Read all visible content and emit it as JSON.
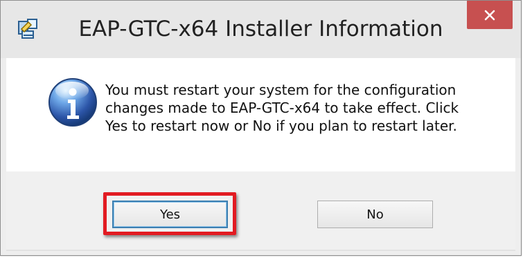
{
  "window": {
    "title": "EAP-GTC-x64 Installer Information",
    "close_icon": "close-icon",
    "app_icon": "installer-icon"
  },
  "dialog": {
    "icon": "info-icon",
    "message": "You must restart your system for the configuration\nchanges made to EAP-GTC-x64 to take effect. Click\nYes to restart now or No if you plan to restart later."
  },
  "buttons": {
    "yes": "Yes",
    "no": "No"
  },
  "colors": {
    "close_button": "#c75050",
    "highlight": "#e21b22",
    "focus_border": "#3c7fb1"
  }
}
